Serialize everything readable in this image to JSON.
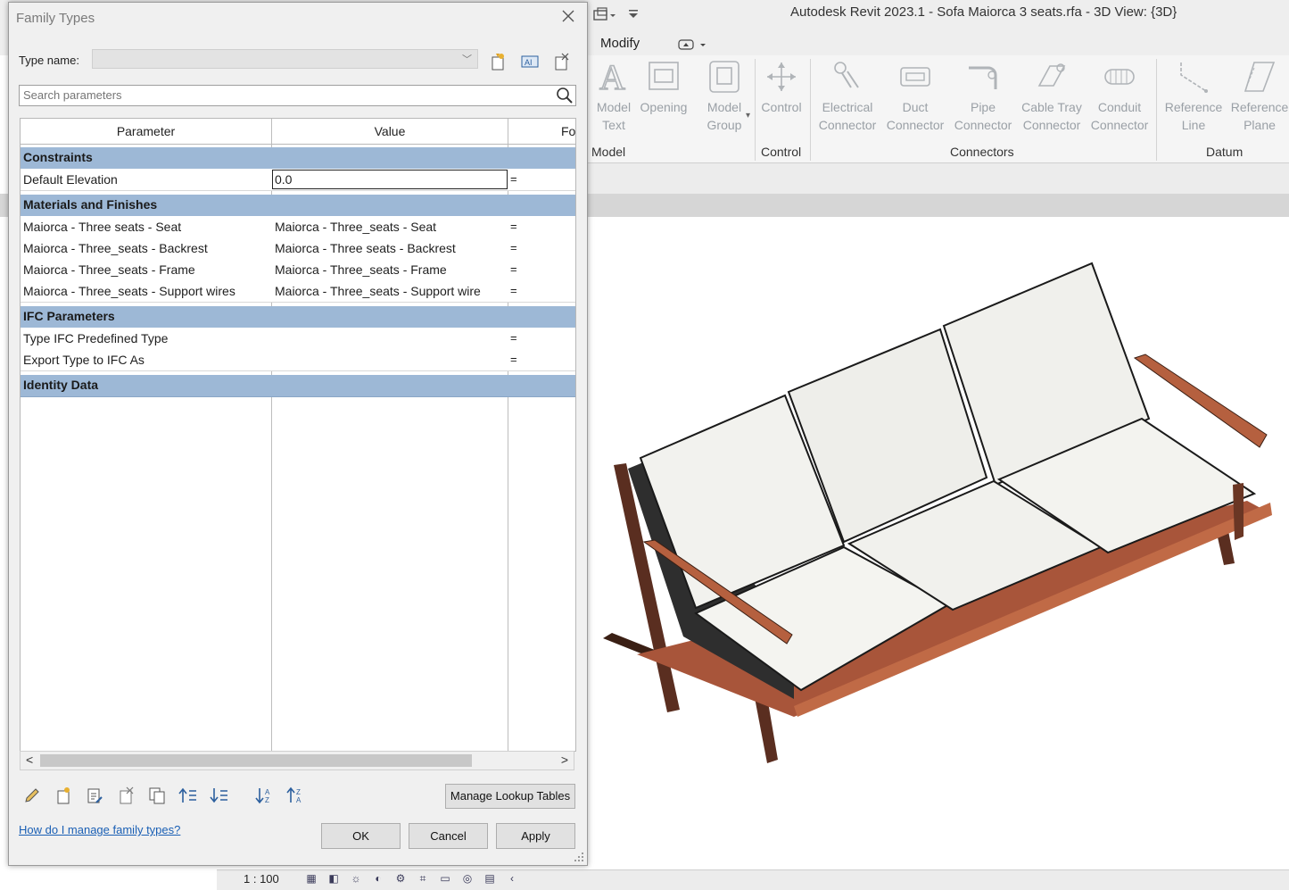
{
  "app": {
    "title": "Autodesk Revit 2023.1 - Sofa Maiorca 3 seats.rfa - 3D View: {3D}"
  },
  "ribbon": {
    "tab_modify": "Modify",
    "buttons": [
      {
        "label1": "Model",
        "label2": "Text",
        "icon": "model-text-icon"
      },
      {
        "label1": "Opening",
        "label2": "",
        "icon": "opening-icon"
      },
      {
        "label1": "Model",
        "label2": "Group",
        "icon": "model-group-icon"
      },
      {
        "label1": "Control",
        "label2": "",
        "icon": "control-icon"
      },
      {
        "label1": "Electrical",
        "label2": "Connector",
        "icon": "electrical-connector-icon"
      },
      {
        "label1": "Duct",
        "label2": "Connector",
        "icon": "duct-connector-icon"
      },
      {
        "label1": "Pipe",
        "label2": "Connector",
        "icon": "pipe-connector-icon"
      },
      {
        "label1": "Cable Tray",
        "label2": "Connector",
        "icon": "cable-tray-connector-icon"
      },
      {
        "label1": "Conduit",
        "label2": "Connector",
        "icon": "conduit-connector-icon"
      },
      {
        "label1": "Reference",
        "label2": "Line",
        "icon": "reference-line-icon"
      },
      {
        "label1": "Reference",
        "label2": "Plane",
        "icon": "reference-plane-icon"
      }
    ],
    "panels": {
      "model": "Model",
      "control": "Control",
      "connectors": "Connectors",
      "datum": "Datum"
    }
  },
  "status": {
    "scale": "1 : 100"
  },
  "dialog": {
    "title": "Family Types",
    "type_name_label": "Type name:",
    "type_name_value": "",
    "search_placeholder": "Search parameters",
    "columns": {
      "parameter": "Parameter",
      "value": "Value",
      "formula": "Fo"
    },
    "groups": {
      "constraints": "Constraints",
      "materials": "Materials and Finishes",
      "ifc": "IFC Parameters",
      "identity": "Identity Data"
    },
    "rows": {
      "default_elevation": {
        "name": "Default Elevation",
        "value": "0.0",
        "formula": "="
      },
      "seat": {
        "name": "Maiorca - Three seats - Seat",
        "value": "Maiorca - Three_seats - Seat",
        "formula": "="
      },
      "backrest": {
        "name": "Maiorca - Three_seats - Backrest",
        "value": "Maiorca - Three seats - Backrest",
        "formula": "="
      },
      "frame": {
        "name": "Maiorca - Three_seats - Frame",
        "value": "Maiorca - Three_seats - Frame",
        "formula": "="
      },
      "support_wires": {
        "name": "Maiorca - Three_seats - Support wires",
        "value": "Maiorca - Three_seats - Support wire",
        "formula": "="
      },
      "ifc_predefined": {
        "name": "Type IFC Predefined Type",
        "value": "",
        "formula": "="
      },
      "ifc_export": {
        "name": "Export Type to IFC As",
        "value": "",
        "formula": "="
      }
    },
    "manage_lookup": "Manage Lookup Tables",
    "help_link": "How do I manage family types?",
    "ok": "OK",
    "cancel": "Cancel",
    "apply": "Apply"
  }
}
